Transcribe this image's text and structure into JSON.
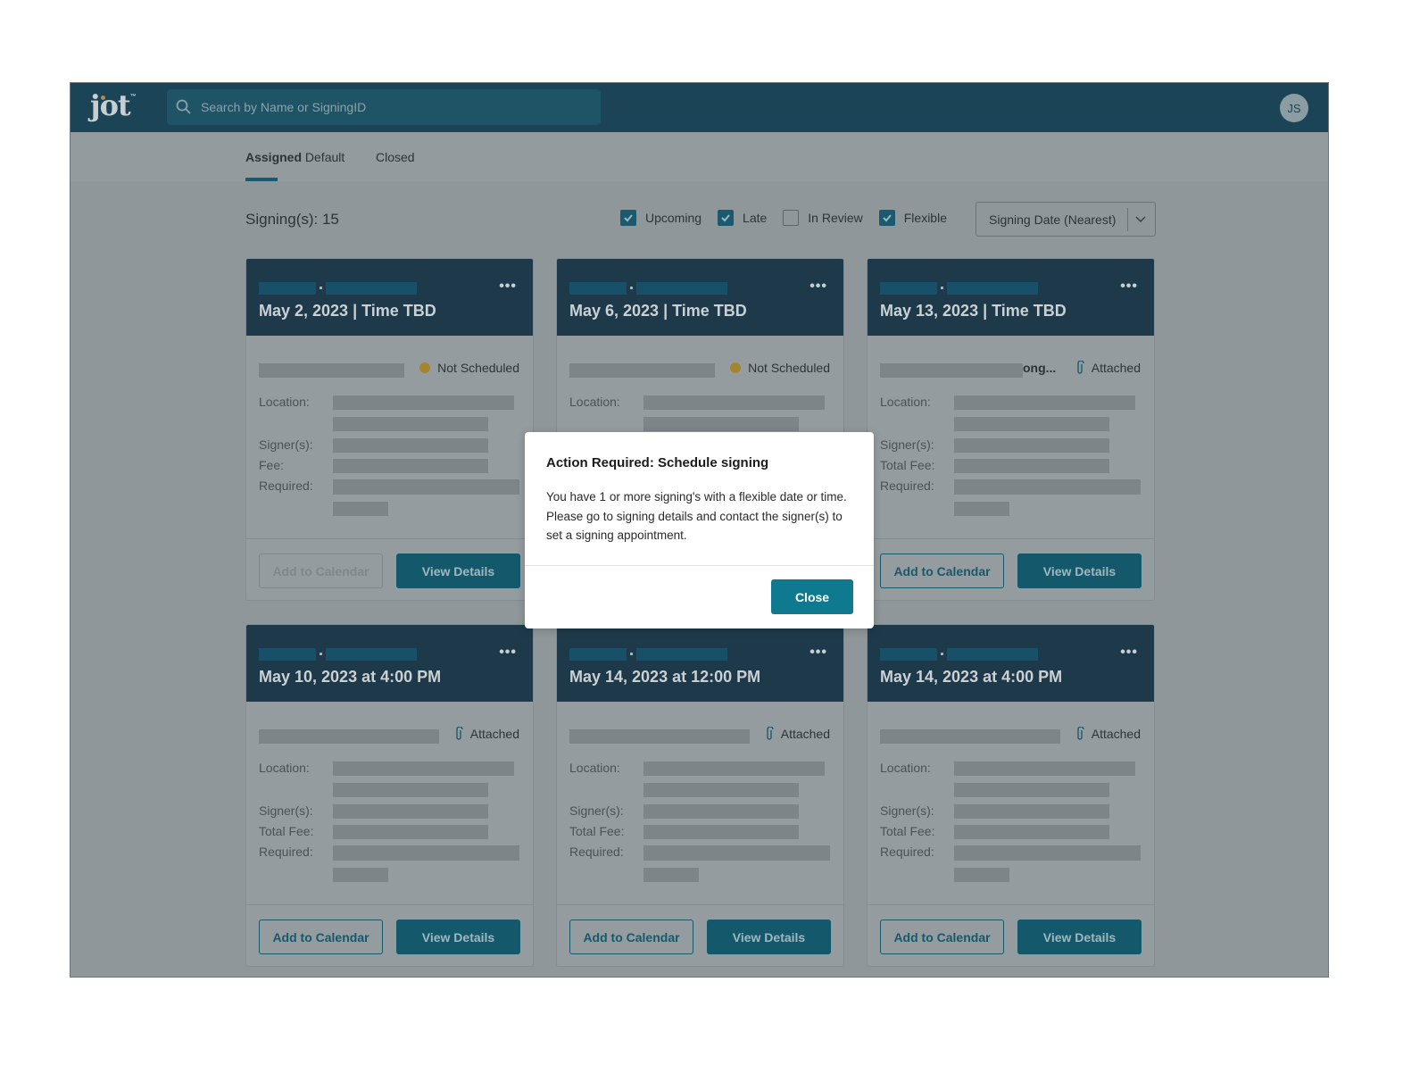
{
  "header": {
    "logo": "jot",
    "search_placeholder": "Search by Name or SigningID",
    "avatar_initials": "JS"
  },
  "tabs": [
    {
      "label": "Assigned",
      "sublabel": "Default",
      "active": true
    },
    {
      "label": "Closed",
      "active": false
    }
  ],
  "toolbar": {
    "count_label": "Signing(s): 15",
    "filters": [
      {
        "label": "Upcoming",
        "checked": true
      },
      {
        "label": "Late",
        "checked": true
      },
      {
        "label": "In Review",
        "checked": false
      },
      {
        "label": "Flexible",
        "checked": true
      }
    ],
    "sort": "Signing Date (Nearest)"
  },
  "labels": {
    "location": "Location:",
    "signers": "Signer(s):",
    "fee": "Fee:",
    "total_fee": "Total Fee:",
    "required": "Required:",
    "add_to_calendar": "Add to Calendar",
    "view_details": "View Details",
    "more": "•••"
  },
  "cards": [
    {
      "date": "May 2, 2023 | Time TBD",
      "status": "Not Scheduled",
      "status_icon": "warning-dot",
      "fee_label": "Fee:",
      "calendar_disabled": true,
      "truncated": ""
    },
    {
      "date": "May 6, 2023 | Time TBD",
      "status": "Not Scheduled",
      "status_icon": "warning-dot",
      "fee_label": "Fee:",
      "calendar_disabled": true,
      "truncated": ""
    },
    {
      "date": "May 13, 2023 | Time TBD",
      "status": "Attached",
      "status_icon": "paperclip-icon",
      "fee_label": "Total Fee:",
      "calendar_disabled": false,
      "truncated": "ong..."
    },
    {
      "date": "May 10, 2023 at 4:00 PM",
      "status": "Attached",
      "status_icon": "paperclip-icon",
      "fee_label": "Total Fee:",
      "calendar_disabled": false,
      "truncated": ""
    },
    {
      "date": "May 14, 2023 at 12:00 PM",
      "status": "Attached",
      "status_icon": "paperclip-icon",
      "fee_label": "Total Fee:",
      "calendar_disabled": false,
      "truncated": ""
    },
    {
      "date": "May 14, 2023 at 4:00 PM",
      "status": "Attached",
      "status_icon": "paperclip-icon",
      "fee_label": "Total Fee:",
      "calendar_disabled": false,
      "truncated": ""
    }
  ],
  "modal": {
    "title": "Action Required: Schedule signing",
    "body": "You have 1 or more signing's with a flexible date or time. Please go to signing details and contact the signer(s) to set a signing appointment.",
    "close_label": "Close"
  },
  "colors": {
    "header": "#1b4557",
    "accent": "#0f7a8f",
    "card_header": "#1e3a4a"
  }
}
